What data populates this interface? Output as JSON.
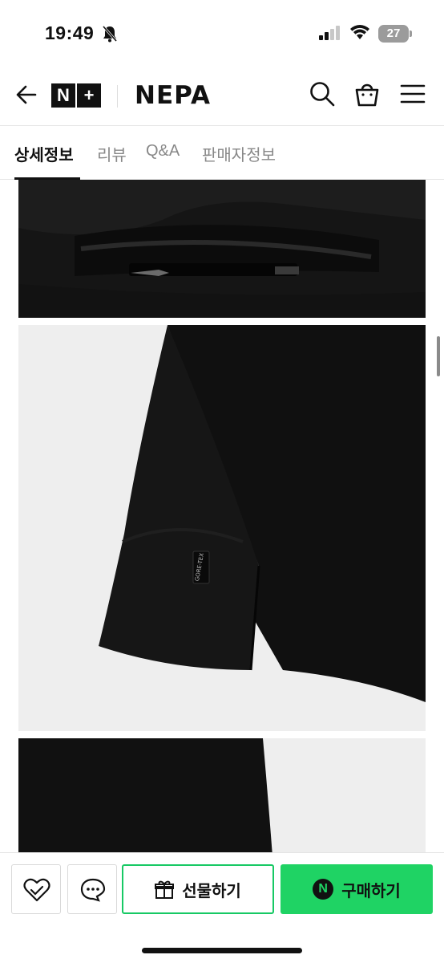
{
  "status_bar": {
    "time": "19:49",
    "battery": "27"
  },
  "header": {
    "logo_mark": [
      "N",
      "+"
    ],
    "brand": "NEPA"
  },
  "tabs": [
    {
      "label": "상세정보",
      "active": true
    },
    {
      "label": "리뷰",
      "active": false
    },
    {
      "label": "Q&A",
      "active": false
    },
    {
      "label": "판매자정보",
      "active": false
    }
  ],
  "product_images": [
    {
      "name": "jacket-hood-detail-image"
    },
    {
      "name": "jacket-sleeve-image",
      "label": "GORE-TEX"
    },
    {
      "name": "jacket-side-image"
    }
  ],
  "bottom_bar": {
    "like_icon": "heart-icon",
    "chat_icon": "chat-bubble-icon",
    "gift_label": "선물하기",
    "buy_badge": "N",
    "buy_label": "구매하기"
  },
  "colors": {
    "accent": "#1fd364",
    "dark": "#111111"
  }
}
